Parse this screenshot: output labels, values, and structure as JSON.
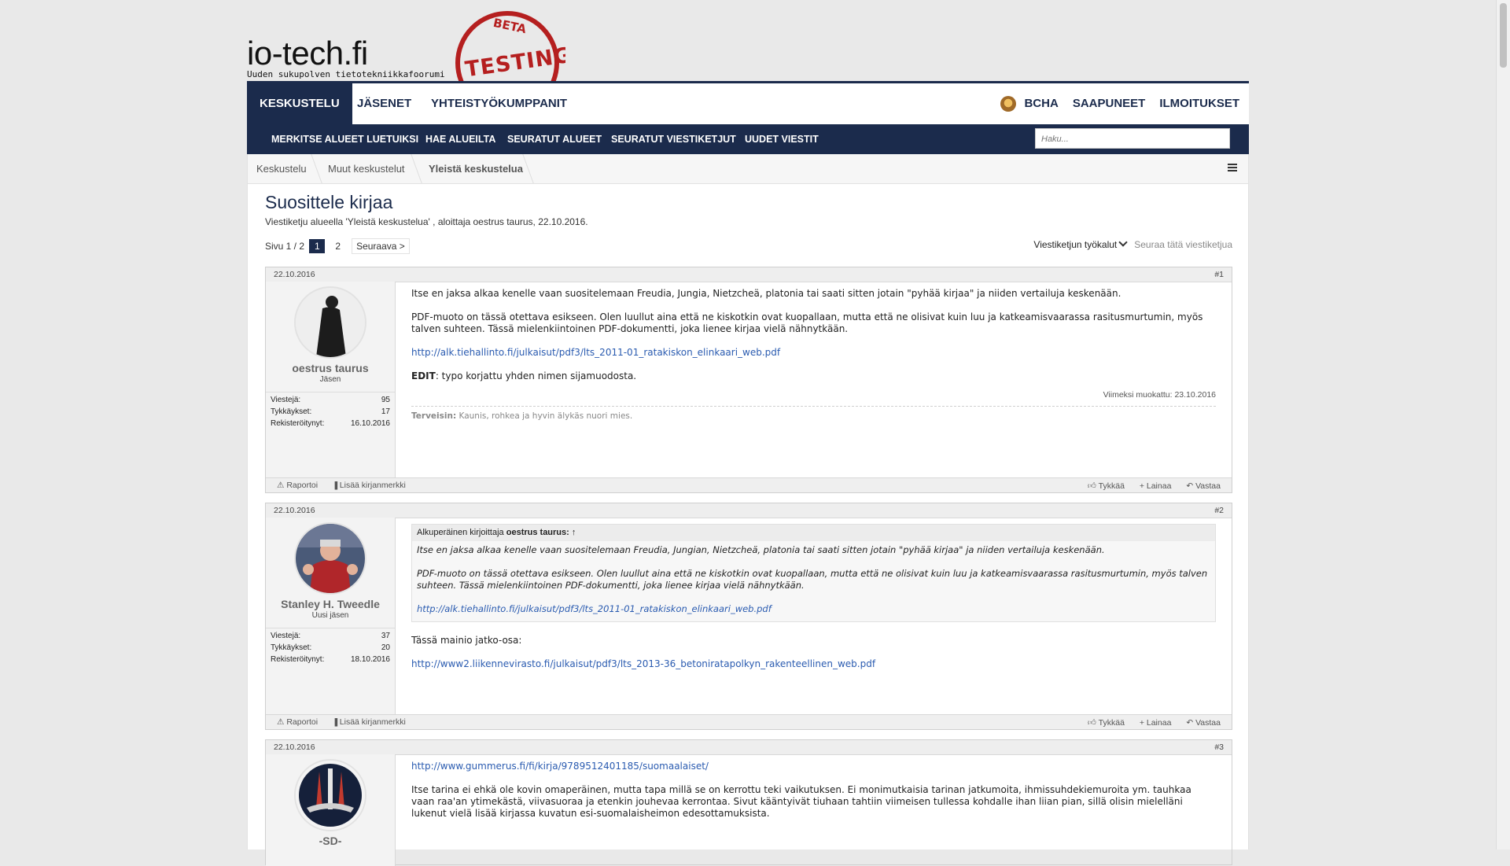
{
  "site": {
    "name": "io-tech.fi",
    "tagline": "Uuden sukupolven tietotekniikkafoorumi",
    "stamp_top": "BETA",
    "stamp_main": "TESTING"
  },
  "nav": {
    "tabs": [
      "KESKUSTELU",
      "JÄSENET",
      "YHTEISTYÖKUMPPANIT"
    ],
    "user": "BCHA",
    "inbox": "SAAPUNEET",
    "alerts": "ILMOITUKSET"
  },
  "subnav": {
    "items": [
      "MERKITSE ALUEET LUETUIKSI",
      "HAE ALUEILTA",
      "SEURATUT ALUEET",
      "SEURATUT VIESTIKETJUT",
      "UUDET VIESTIT"
    ],
    "search_placeholder": "Haku..."
  },
  "breadcrumb": [
    "Keskustelu",
    "Muut keskustelut",
    "Yleistä keskustelua"
  ],
  "thread": {
    "title": "Suosittele kirjaa",
    "subtitle": "Viestiketju alueella 'Yleistä keskustelua' , aloittaja oestrus taurus, 22.10.2016.",
    "page_label": "Sivu 1 / 2",
    "pages": [
      "1",
      "2"
    ],
    "next": "Seuraava >",
    "tools": "Viestiketjun työkalut",
    "follow": "Seuraa tätä viestiketjua"
  },
  "stat_labels": {
    "posts": "Viestejä:",
    "likes": "Tykkäykset:",
    "registered": "Rekisteröitynyt:"
  },
  "post_actions": {
    "report": "Raportoi",
    "bookmark": "Lisää kirjanmerkki",
    "like": "Tykkää",
    "quote": "+ Lainaa",
    "reply": "Vastaa"
  },
  "posts": [
    {
      "date": "22.10.2016",
      "number": "#1",
      "user": {
        "name": "oestrus taurus",
        "role": "Jäsen",
        "posts": "95",
        "likes": "17",
        "registered": "16.10.2016"
      },
      "p1": "Itse en jaksa alkaa kenelle vaan suositelemaan Freudia, Jungia, Nietzcheä, platonia tai saati sitten jotain \"pyhää kirjaa\" ja niiden vertailuja keskenään.",
      "p2": "PDF-muoto on tässä otettava esikseen. Olen luullut aina että ne kiskotkin ovat kuopallaan, mutta että ne olisivat kuin luu ja katkeamisvaarassa rasitusmurtumin, myös talven suhteen. Tässä mielenkiintoinen PDF-dokumentti, joka lienee kirjaa vielä nähnytkään.",
      "link": "http://alk.tiehallinto.fi/julkaisut/pdf3/lts_2011-01_ratakiskon_elinkaari_web.pdf",
      "edit_label": "EDIT",
      "edit_text": ": typo korjattu yhden nimen sijamuodosta.",
      "last_edit": "Viimeksi muokattu: 23.10.2016",
      "sig_label": "Terveisin:",
      "sig_text": "Kaunis, rohkea ja hyvin älykäs nuori mies."
    },
    {
      "date": "22.10.2016",
      "number": "#2",
      "user": {
        "name": "Stanley H. Tweedle",
        "role": "Uusi jäsen",
        "posts": "37",
        "likes": "20",
        "registered": "18.10.2016"
      },
      "quote_head": "Alkuperäinen kirjoittaja",
      "quote_author": "oestrus taurus:",
      "quote_p1": "Itse en jaksa alkaa kenelle vaan suositelemaan Freudia, Jungian, Nietzcheä, platonia tai saati sitten jotain \"pyhää kirjaa\" ja niiden vertailuja keskenään.",
      "quote_p2": "PDF-muoto on tässä otettava esikseen. Olen luullut aina että ne kiskotkin ovat kuopallaan, mutta että ne olisivat kuin luu ja katkeamisvaarassa rasitusmurtumin, myös talven suhteen. Tässä mielenkiintoinen PDF-dokumentti, joka lienee kirjaa vielä nähnytkään.",
      "quote_link": "http://alk.tiehallinto.fi/julkaisut/pdf3/lts_2011-01_ratakiskon_elinkaari_web.pdf",
      "p1": "Tässä mainio jatko-osa:",
      "link": "http://www2.liikennevirasto.fi/julkaisut/pdf3/lts_2013-36_betoniratapolkyn_rakenteellinen_web.pdf"
    },
    {
      "date": "22.10.2016",
      "number": "#3",
      "user": {
        "name": "-SD-"
      },
      "link": "http://www.gummerus.fi/fi/kirja/9789512401185/suomaalaiset/",
      "p1": "Itse tarina ei ehkä ole kovin omaperäinen, mutta tapa millä se on kerrottu teki vaikutuksen. Ei monimutkaisia tarinan jatkumoita, ihmissuhdekiemuroita ym. tauhkaa vaan raa'an ytimekästä, viivasuoraa ja etenkin jouhevaa kerrontaa. Sivut kääntyivät tiuhaan tahtiin viimeisen tullessa kohdalle ihan liian pian, sillä olisin mielelläni lukenut vielä lisää kirjassa kuvatun esi-suomalaisheimon edesottamuksista."
    }
  ]
}
